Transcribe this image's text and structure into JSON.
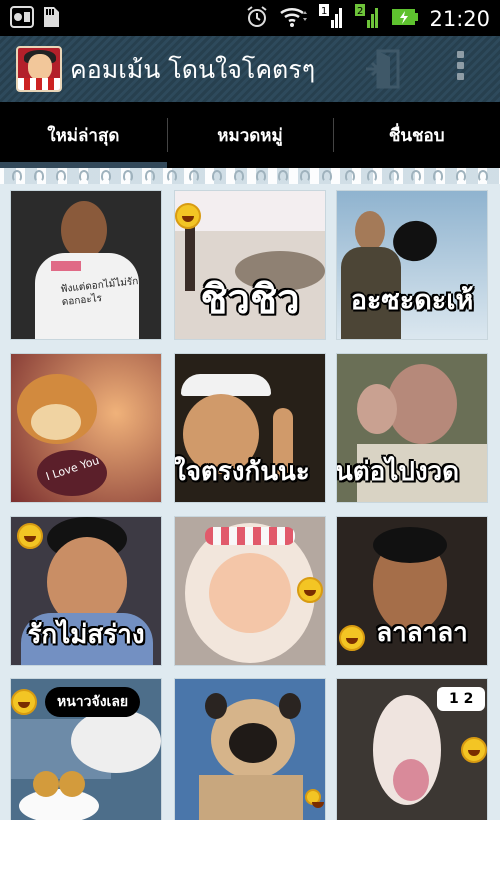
{
  "status_bar": {
    "time": "21:20",
    "left_icons": [
      "usb-debug-icon",
      "sd-card-icon"
    ],
    "right_icons": [
      "alarm-icon",
      "wifi-icon",
      "signal-1-icon",
      "signal-2-icon",
      "battery-charging-icon"
    ],
    "signal_1_label": "1",
    "signal_2_label": "2"
  },
  "action_bar": {
    "title": "คอมเม้น โดนใจโคตรๆ",
    "icons": [
      "app-logo-icon",
      "exit-icon",
      "overflow-menu-icon"
    ]
  },
  "tabs": [
    {
      "label": "ใหม่ล่าสุด",
      "active": true
    },
    {
      "label": "หมวดหมู่",
      "active": false
    },
    {
      "label": "ชื่นชอบ",
      "active": false
    }
  ],
  "grid": {
    "items": [
      {
        "caption": "",
        "bubble": "",
        "shirt_text": "ฟังแต่ดอกไม้ไม่รักดอกอะไร"
      },
      {
        "caption": "ชิวชิว",
        "bubble": ""
      },
      {
        "caption": "อะซะดะเห้",
        "bubble": ""
      },
      {
        "caption": "",
        "bubble": ""
      },
      {
        "caption": "ใจตรงกันนะ",
        "bubble": ""
      },
      {
        "caption": "นต่อไปงวด",
        "bubble": ""
      },
      {
        "caption": "รักไม่สร่าง",
        "bubble": ""
      },
      {
        "caption": "ลาลาลา",
        "bubble": ""
      },
      {
        "caption": "",
        "bubble": ""
      },
      {
        "caption": "",
        "bubble": "หนาวจังเลย"
      },
      {
        "caption": "",
        "bubble": ""
      },
      {
        "caption": "",
        "bubble": "1 2"
      }
    ],
    "bear_text": "I Love You"
  },
  "colors": {
    "action_bar": "#2e4a5c",
    "tabs_bg": "#000000",
    "tab_indicator": "#33495a",
    "content_bg": "#dfeaf0"
  }
}
